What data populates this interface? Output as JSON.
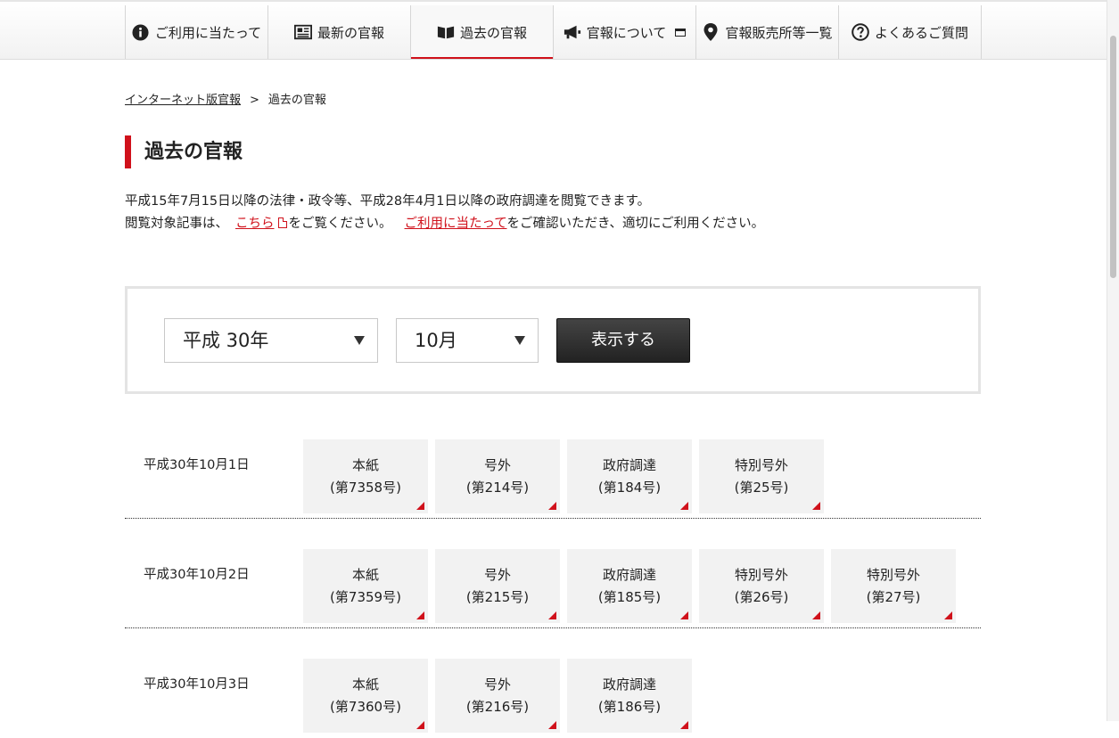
{
  "nav": {
    "items": [
      {
        "label": "ご利用に当たって",
        "icon": "info-icon"
      },
      {
        "label": "最新の官報",
        "icon": "newspaper-icon"
      },
      {
        "label": "過去の官報",
        "icon": "book-icon"
      },
      {
        "label": "官報について",
        "icon": "megaphone-icon"
      },
      {
        "label": "官報販売所等一覧",
        "icon": "map-pin-icon"
      },
      {
        "label": "よくあるご質問",
        "icon": "question-icon"
      }
    ],
    "active": "過去の官報"
  },
  "breadcrumb": {
    "home": "インターネット版官報",
    "separator": ">",
    "current": "過去の官報"
  },
  "page": {
    "title": "過去の官報"
  },
  "intro": {
    "line1": "平成15年7月15日以降の法律・政令等、平成28年4月1日以降の政府調達を閲覧できます。",
    "line2_prefix": "閲覧対象記事は、",
    "link_here": "こちら",
    "line2_mid": "をご覧ください。",
    "link_usage": "ご利用に当たって",
    "line2_suffix": "をご確認いただき、適切にご利用ください。"
  },
  "selector": {
    "year": "平成 30年",
    "month": "10月",
    "show_button": "表示する"
  },
  "rows": [
    {
      "date": "平成30年10月1日",
      "issues": [
        {
          "type": "本紙",
          "number": "(第7358号)"
        },
        {
          "type": "号外",
          "number": "(第214号)"
        },
        {
          "type": "政府調達",
          "number": "(第184号)"
        },
        {
          "type": "特別号外",
          "number": "(第25号)"
        }
      ]
    },
    {
      "date": "平成30年10月2日",
      "issues": [
        {
          "type": "本紙",
          "number": "(第7359号)"
        },
        {
          "type": "号外",
          "number": "(第215号)"
        },
        {
          "type": "政府調達",
          "number": "(第185号)"
        },
        {
          "type": "特別号外",
          "number": "(第26号)"
        },
        {
          "type": "特別号外",
          "number": "(第27号)"
        }
      ]
    },
    {
      "date": "平成30年10月3日",
      "issues": [
        {
          "type": "本紙",
          "number": "(第7360号)"
        },
        {
          "type": "号外",
          "number": "(第216号)"
        },
        {
          "type": "政府調達",
          "number": "(第186号)"
        }
      ]
    }
  ],
  "colors": {
    "accent": "#d0111b",
    "button": "#2a2a2a",
    "tile": "#f2f2f2"
  }
}
